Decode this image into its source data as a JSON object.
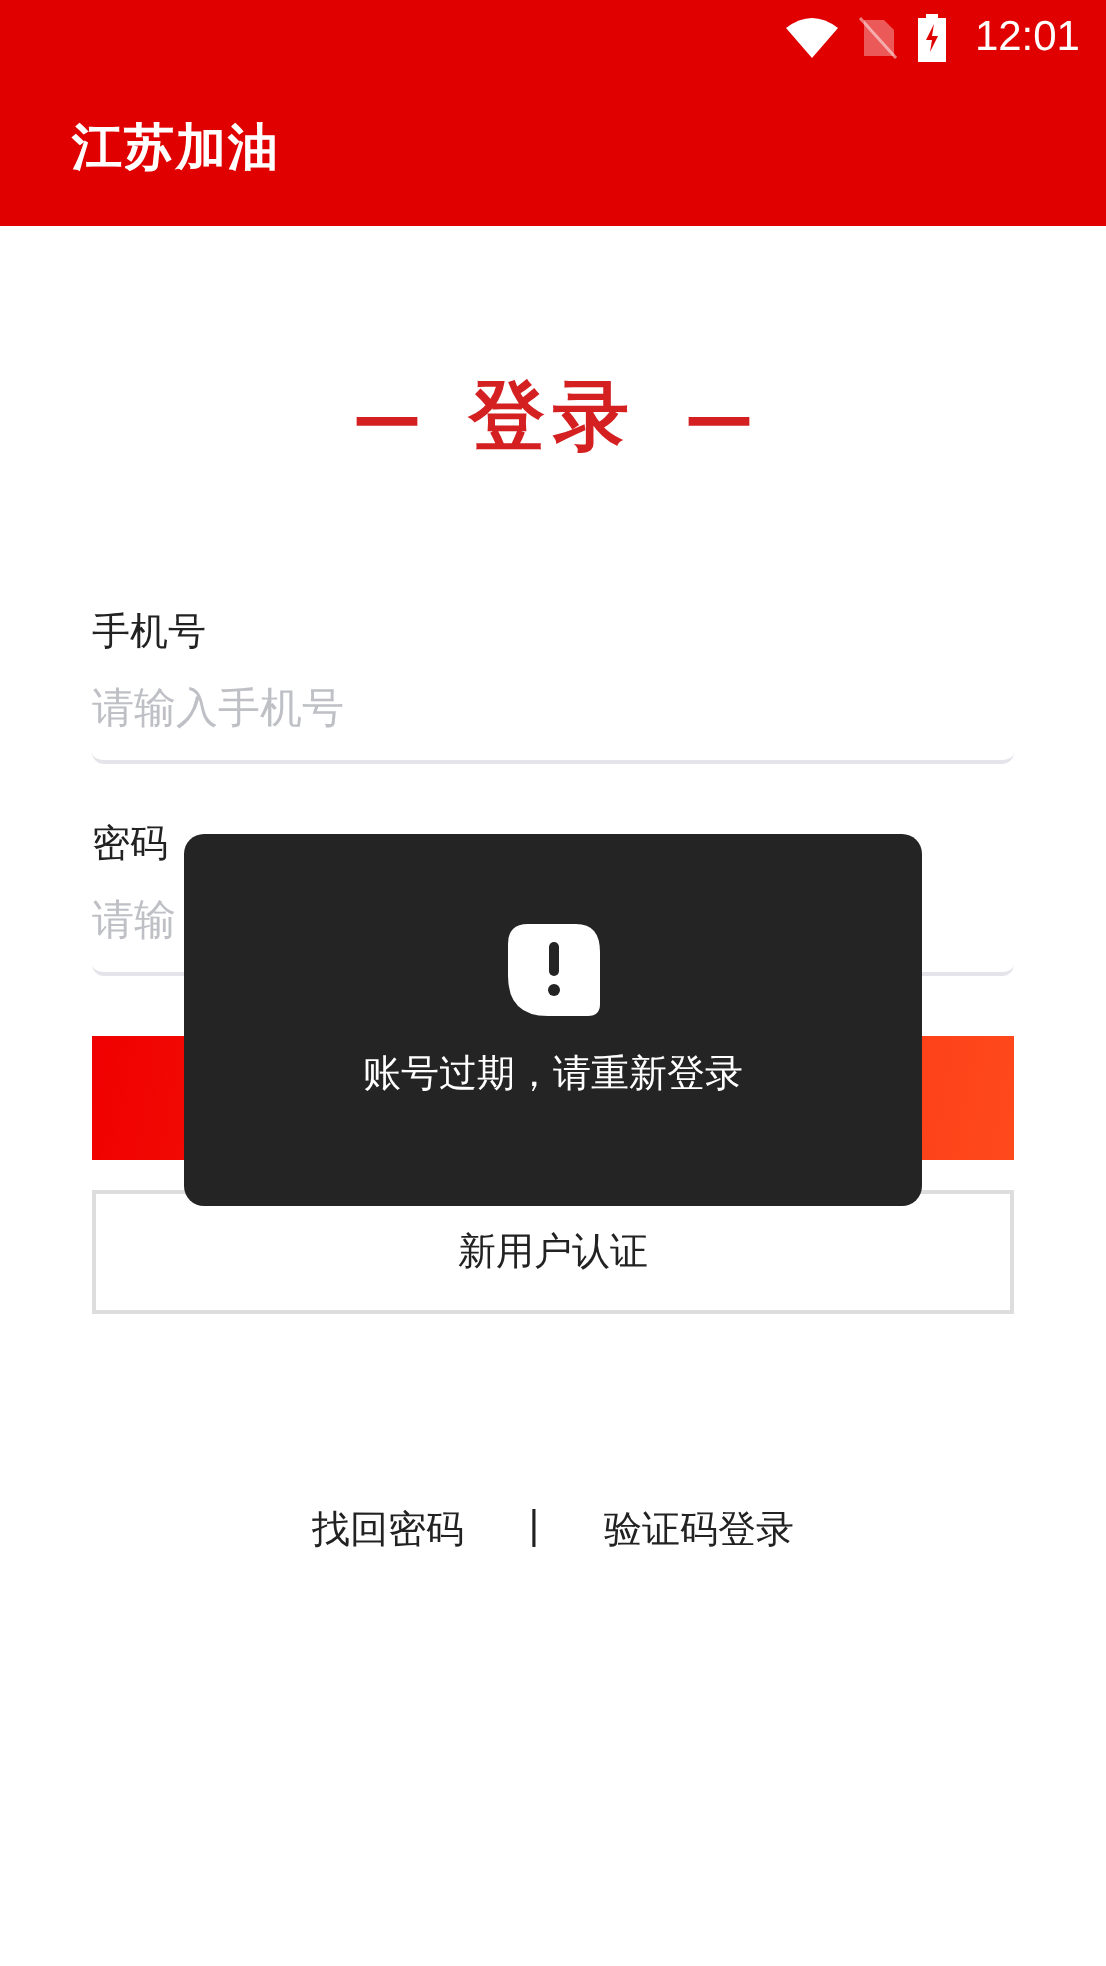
{
  "status_bar": {
    "time": "12:01"
  },
  "app_bar": {
    "title": "江苏加油"
  },
  "heading": {
    "dash_left": "—",
    "title": "登录",
    "dash_right": "—"
  },
  "fields": [
    {
      "label": "手机号",
      "placeholder": "请输入手机号"
    },
    {
      "label": "密码",
      "placeholder": "请输"
    }
  ],
  "register_button": "新用户认证",
  "links": [
    {
      "label": "找回密码"
    },
    {
      "label": "验证码登录"
    }
  ],
  "link_separator": "|",
  "toast": {
    "message": "账号过期，请重新登录"
  }
}
